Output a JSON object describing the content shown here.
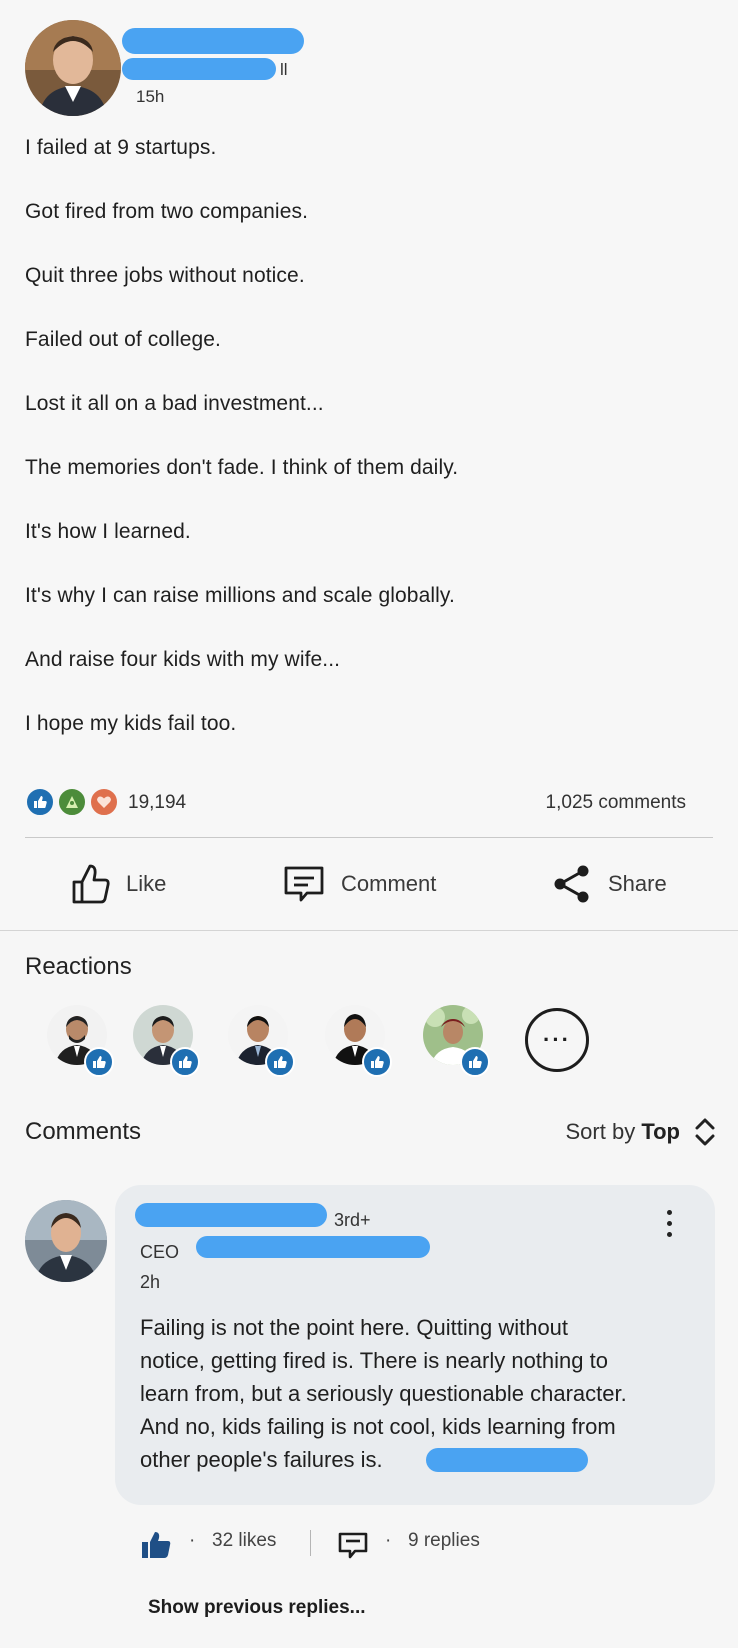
{
  "post": {
    "time": "15h",
    "lines": [
      "I failed at 9 startups.",
      "Got fired from two companies.",
      "Quit three jobs without notice.",
      "Failed out of college.",
      "Lost it all on a bad investment...",
      "The memories don't fade. I think of them daily.",
      "It's how I learned.",
      "It's why I can raise millions and scale globally.",
      "And raise four kids with my wife...",
      "I hope my kids fail too."
    ],
    "reaction_count": "19,194",
    "comment_count": "1,025 comments",
    "reaction_icons": [
      "like-icon",
      "celebrate-icon",
      "love-icon"
    ]
  },
  "actions": {
    "like": "Like",
    "comment": "Comment",
    "share": "Share"
  },
  "reactions": {
    "title": "Reactions",
    "more_label": "···"
  },
  "comments": {
    "title": "Comments",
    "sort_prefix": "Sort by ",
    "sort_value": "Top",
    "item": {
      "degree": "3rd+",
      "headline_prefix": "CEO",
      "time": "2h",
      "text_lines": [
        "Failing is not the point here. Quitting without",
        "notice, getting fired is. There is nearly nothing to",
        "learn from, but a seriously questionable character.",
        "And no, kids failing is not cool, kids learning from",
        "other people's failures is."
      ],
      "likes": "32 likes",
      "replies": "9 replies",
      "dot": "·"
    },
    "show_previous": "Show previous replies..."
  },
  "colors": {
    "redaction": "#4aa3f2",
    "like_badge": "#1f6fb2",
    "text": "#1d1d1d"
  }
}
